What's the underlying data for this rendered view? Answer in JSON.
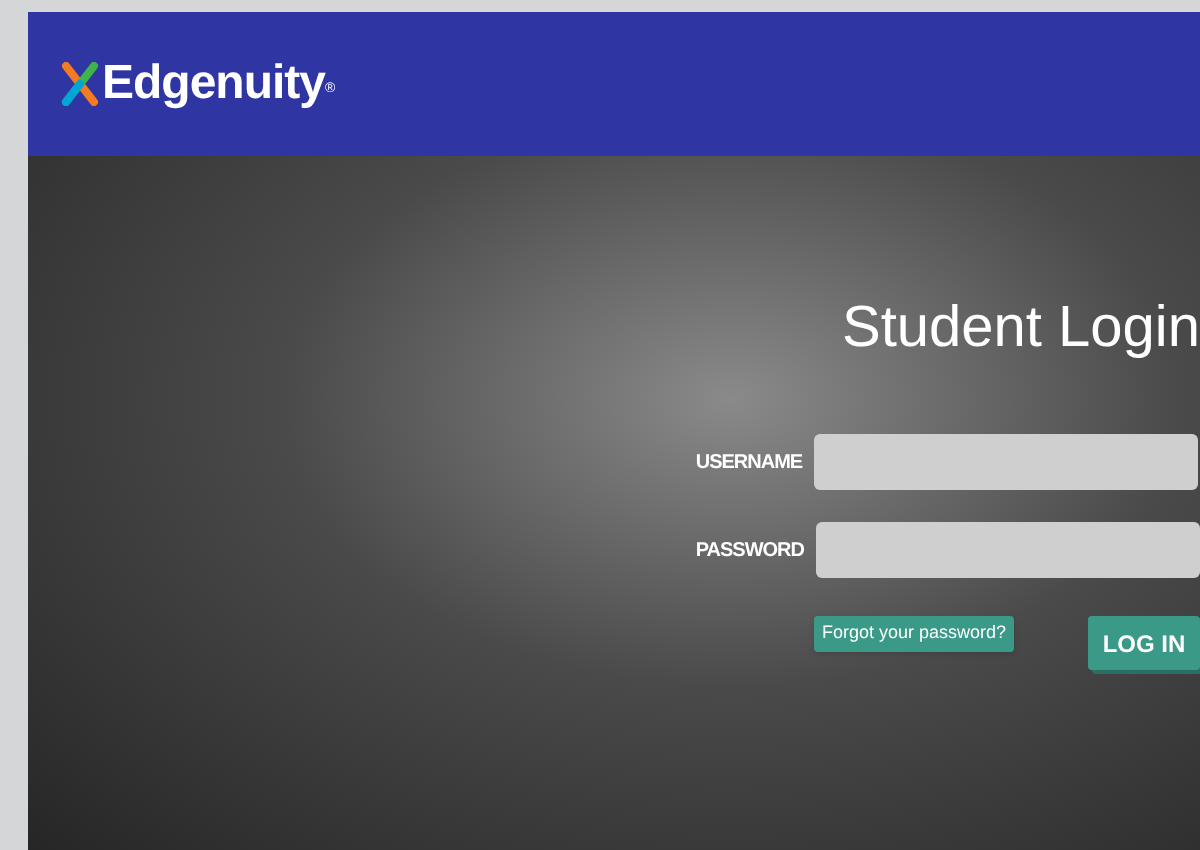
{
  "header": {
    "brand": "Edgenuity$^{®}$"
  },
  "login": {
    "title": "Student Login",
    "fields": [
      {
        "label": "USERNAME"
      },
      {
        "label": "PASSWORD"
      }
    ],
    "forgot_link": "Forgot your password?",
    "submit": "LOG IN"
  }
}
